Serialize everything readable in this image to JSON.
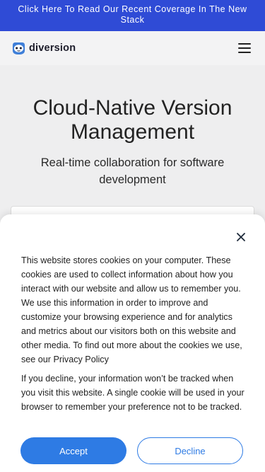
{
  "banner": {
    "text": "Click Here To Read Our Recent Coverage In The New Stack"
  },
  "header": {
    "logo_text": "diversion",
    "logo_icon": "sloth-icon",
    "menu_icon": "hamburger-icon"
  },
  "hero": {
    "title": "Cloud-Native Version Management",
    "subtitle": "Real-time collaboration for software development"
  },
  "cookie": {
    "close_icon": "close-icon",
    "paragraph1": "This website stores cookies on your computer. These cookies are used to collect information about how you interact with our website and allow us to remember you. We use this information in order to improve and customize your browsing experience and for analytics and metrics about our visitors both on this website and other media. To find out more about the cookies we use, see our Privacy Policy",
    "paragraph2": "If you decline, your information won’t be tracked when you visit this website. A single cookie will be used in your browser to remember your preference not to be tracked.",
    "accept_label": "Accept",
    "decline_label": "Decline"
  },
  "colors": {
    "banner": "#2f4bd6",
    "accent": "#2e7be4",
    "logo_blue": "#3f7fd8"
  }
}
